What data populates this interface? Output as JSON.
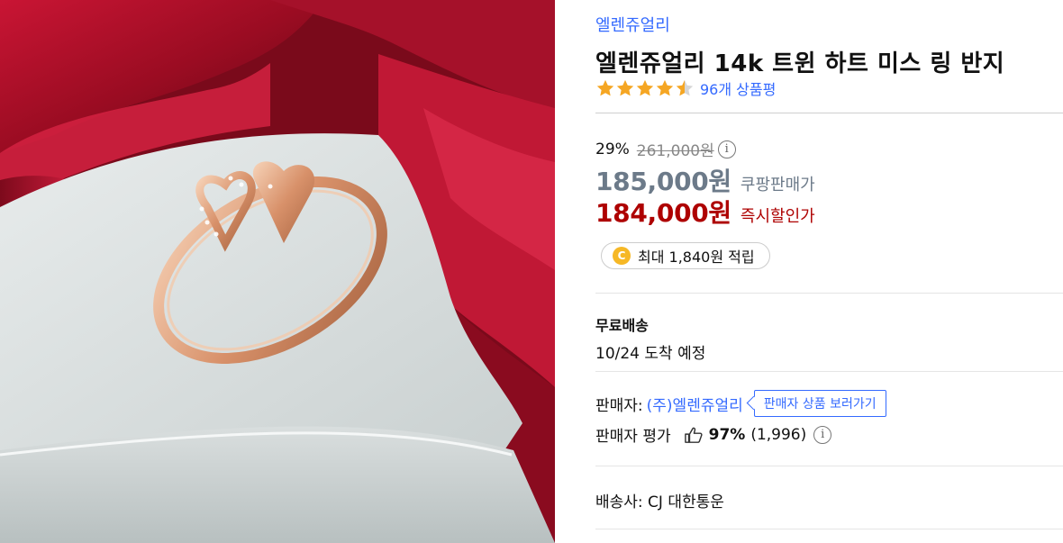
{
  "product": {
    "brand": "엘렌쥬얼리",
    "title": "엘렌쥬얼리 14k 트윈 하트 미스 링 반지",
    "rating_stars": 4.5,
    "review_count": "96개 상품평",
    "image_alt": "rose gold twin heart ring on red ribbon gift box"
  },
  "pricing": {
    "discount_rate": "29%",
    "original_price": "261,000원",
    "info_icon": "i",
    "coupang_price": "185,000원",
    "coupang_price_label": "쿠팡판매가",
    "instant_price": "184,000원",
    "instant_price_label": "즉시할인가"
  },
  "reward": {
    "coin_symbol": "C",
    "text": "최대 1,840원 적립"
  },
  "shipping": {
    "title": "무료배송",
    "arrival": "10/24 도착 예정"
  },
  "seller": {
    "label": "판매자:",
    "name": "(주)엘렌쥬얼리",
    "link_label": "판매자 상품 보러가기",
    "rating_label": "판매자 평가",
    "rating_percent": "97%",
    "rating_count": "(1,996)"
  },
  "carrier": {
    "text": "배송사: CJ 대한통운"
  },
  "colors": {
    "link_blue": "#346aff",
    "price_gray": "#6c7a89",
    "price_red": "#ae0000",
    "star_orange": "#f5a623",
    "coin_yellow": "#f6b826"
  },
  "icons": [
    "star-icon",
    "info-icon",
    "coin-icon",
    "thumbs-up-icon"
  ]
}
